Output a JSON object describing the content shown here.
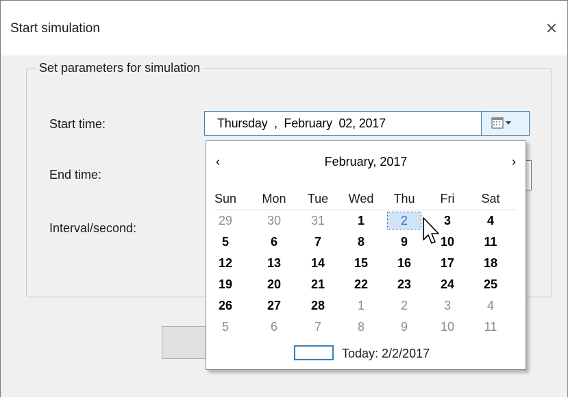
{
  "window": {
    "title": "Start simulation",
    "close_glyph": "✕"
  },
  "group": {
    "legend": "Set parameters for simulation"
  },
  "form": {
    "start_label": "Start time:",
    "end_label": "End time:",
    "interval_label": "Interval/second:",
    "start_value": "Thursday  ,  February  02, 2017"
  },
  "calendar": {
    "prev": "‹",
    "next": "›",
    "month_title": "February, 2017",
    "weekdays": [
      "Sun",
      "Mon",
      "Tue",
      "Wed",
      "Thu",
      "Fri",
      "Sat"
    ],
    "weeks": [
      [
        {
          "d": "29",
          "o": true
        },
        {
          "d": "30",
          "o": true
        },
        {
          "d": "31",
          "o": true
        },
        {
          "d": "1"
        },
        {
          "d": "2",
          "sel": true
        },
        {
          "d": "3"
        },
        {
          "d": "4"
        }
      ],
      [
        {
          "d": "5"
        },
        {
          "d": "6"
        },
        {
          "d": "7"
        },
        {
          "d": "8"
        },
        {
          "d": "9"
        },
        {
          "d": "10"
        },
        {
          "d": "11"
        }
      ],
      [
        {
          "d": "12"
        },
        {
          "d": "13"
        },
        {
          "d": "14"
        },
        {
          "d": "15"
        },
        {
          "d": "16"
        },
        {
          "d": "17"
        },
        {
          "d": "18"
        }
      ],
      [
        {
          "d": "19"
        },
        {
          "d": "20"
        },
        {
          "d": "21"
        },
        {
          "d": "22"
        },
        {
          "d": "23"
        },
        {
          "d": "24"
        },
        {
          "d": "25"
        }
      ],
      [
        {
          "d": "26"
        },
        {
          "d": "27"
        },
        {
          "d": "28"
        },
        {
          "d": "1",
          "o": true
        },
        {
          "d": "2",
          "o": true
        },
        {
          "d": "3",
          "o": true
        },
        {
          "d": "4",
          "o": true
        }
      ],
      [
        {
          "d": "5",
          "o": true
        },
        {
          "d": "6",
          "o": true
        },
        {
          "d": "7",
          "o": true
        },
        {
          "d": "8",
          "o": true
        },
        {
          "d": "9",
          "o": true
        },
        {
          "d": "10",
          "o": true
        },
        {
          "d": "11",
          "o": true
        }
      ]
    ],
    "today_label": "Today: 2/2/2017"
  },
  "icons": {
    "calendar_dropdown": "calendar-dropdown-icon",
    "cursor": "pointer-cursor-icon"
  },
  "colors": {
    "accent_border": "#3c7fb1",
    "selected_text": "#2f6fb8",
    "other_month_text": "#8c8c8c"
  }
}
